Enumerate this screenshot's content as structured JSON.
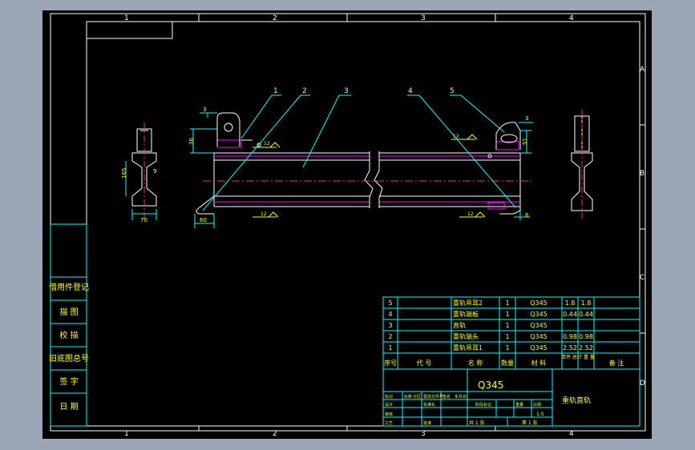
{
  "border": {
    "columns": [
      "1",
      "2",
      "3",
      "4"
    ],
    "rows": [
      "A",
      "B",
      "C",
      "D"
    ]
  },
  "callouts": [
    "1",
    "2",
    "3",
    "4",
    "5"
  ],
  "dimensions": {
    "left_top": "3",
    "left_height": "36",
    "left_bottom": "60",
    "right_top": "3",
    "right_height": "51",
    "right_bottom": "6",
    "weld_a": "12",
    "weld_b": "12",
    "weld_c": "12",
    "weld_d": "12",
    "side_height": "165",
    "side_web": "9",
    "side_width": "70"
  },
  "left_block": [
    "借用件登记",
    "描 图",
    "校 描",
    "旧底图总号",
    "签 字",
    "日 期"
  ],
  "bom": {
    "rows": [
      {
        "no": "5",
        "code": "",
        "name": "重轨吊耳2",
        "qty": "1",
        "material": "Q345",
        "w1": "1.8",
        "w2": "1.8",
        "note": ""
      },
      {
        "no": "4",
        "code": "",
        "name": "重轨端板",
        "qty": "1",
        "material": "Q345",
        "w1": "0.44",
        "w2": "0.44",
        "note": ""
      },
      {
        "no": "3",
        "code": "",
        "name": "直轨",
        "qty": "1",
        "material": "Q345",
        "w1": "",
        "w2": "",
        "note": ""
      },
      {
        "no": "2",
        "code": "",
        "name": "重轨端头",
        "qty": "1",
        "material": "Q345",
        "w1": "0.98",
        "w2": "0.98",
        "note": ""
      },
      {
        "no": "1",
        "code": "",
        "name": "重轨吊耳1",
        "qty": "1",
        "material": "Q345",
        "w1": "2.52",
        "w2": "2.52",
        "note": ""
      }
    ],
    "header": {
      "no": "序号",
      "code": "代 号",
      "name": "名 称",
      "qty": "数量",
      "material": "材 料",
      "weight": "单件 总计 重 量",
      "note": "备 注"
    }
  },
  "title_block": {
    "material": "Q345",
    "drawing_name": "重轨直轨",
    "scale": "1:5",
    "sheet_info": "共 1 张",
    "sheet_no": "第 1 张",
    "labels": [
      "标记",
      "处数",
      "分区",
      "更改文件号",
      "签名",
      "年月日",
      "设计",
      "标准化",
      "阶段标记",
      "重量",
      "比例",
      "审核",
      "工艺",
      "批准"
    ]
  },
  "colors": {
    "frame": "#ffffff",
    "lines": "#00ffff",
    "text": "#ffff00",
    "profile": "#ff00ff",
    "center": "#ff3030",
    "body": "#ffffff",
    "leader": "#00ffff"
  }
}
